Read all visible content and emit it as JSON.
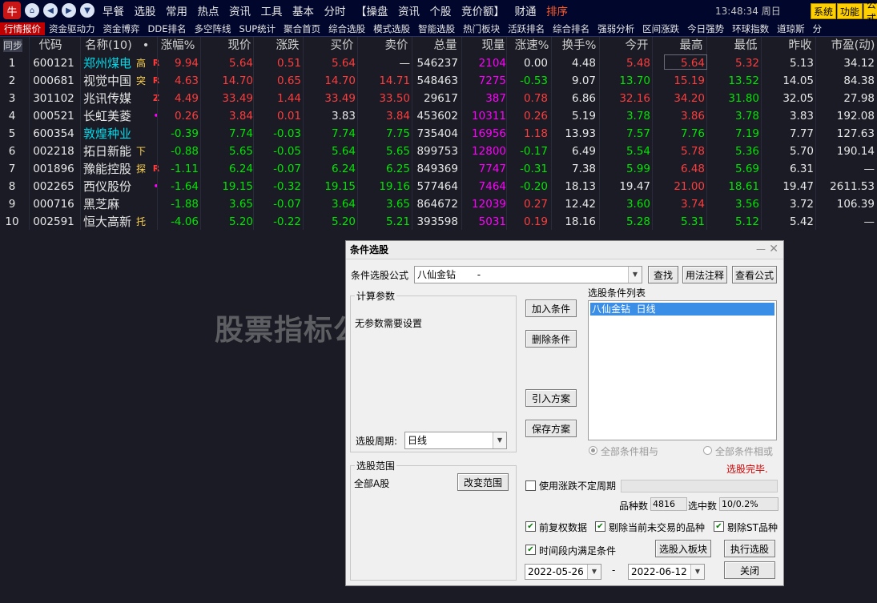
{
  "topbar": {
    "logo": "牛",
    "menu": [
      "早餐",
      "选股",
      "常用",
      "热点",
      "资讯",
      "工具",
      "基本",
      "分时",
      "【操盘",
      "资讯",
      "个股",
      "竞价额】",
      "财通",
      "排序"
    ],
    "clock": "13:48:34 周日",
    "buttons": [
      "系统",
      "功能",
      "公式"
    ]
  },
  "tabs": [
    "行情报价",
    "资金驱动力",
    "资金博弈",
    "DDE排名",
    "多空阵线",
    "SUP统计",
    "聚合首页",
    "综合选股",
    "模式选股",
    "智能选股",
    "热门板块",
    "活跃排名",
    "综合排名",
    "强弱分析",
    "区间涨跌",
    "今日强势",
    "环球指数",
    "道琼斯",
    "分"
  ],
  "table": {
    "headers": [
      "同步",
      "代码",
      "名称(10)",
      "•",
      "涨幅%",
      "现价",
      "涨跌",
      "买价",
      "卖价",
      "总量",
      "现量",
      "涨速%",
      "换手%",
      "今开",
      "最高",
      "最低",
      "昨收",
      "市盈(动)"
    ],
    "rows": [
      {
        "n": "1",
        "code": "600121",
        "name": "郑州煤电",
        "tag": "高",
        "flag": "R",
        "pct": "9.94",
        "price": "5.64",
        "chg": "0.51",
        "bid": "5.64",
        "ask": "—",
        "vol": "546237",
        "cur": "2104",
        "spd": "0.00",
        "turn": "4.48",
        "open": "5.48",
        "high": "5.64",
        "low": "5.32",
        "prev": "5.13",
        "pe": "34.12"
      },
      {
        "n": "2",
        "code": "000681",
        "name": "视觉中国",
        "tag": "突",
        "flag": "R",
        "pct": "4.63",
        "price": "14.70",
        "chg": "0.65",
        "bid": "14.70",
        "ask": "14.71",
        "vol": "548463",
        "cur": "7275",
        "spd": "-0.53",
        "turn": "9.07",
        "open": "13.70",
        "high": "15.19",
        "low": "13.52",
        "prev": "14.05",
        "pe": "84.38"
      },
      {
        "n": "3",
        "code": "301102",
        "name": "兆讯传媒",
        "tag": "",
        "flag": "Z",
        "pct": "4.49",
        "price": "33.49",
        "chg": "1.44",
        "bid": "33.49",
        "ask": "33.50",
        "vol": "29617",
        "cur": "387",
        "spd": "0.78",
        "turn": "6.86",
        "open": "32.16",
        "high": "34.20",
        "low": "31.80",
        "prev": "32.05",
        "pe": "27.98"
      },
      {
        "n": "4",
        "code": "000521",
        "name": "长虹美菱",
        "tag": "",
        "flag": "•",
        "pct": "0.26",
        "price": "3.84",
        "chg": "0.01",
        "bid": "3.83",
        "ask": "3.84",
        "vol": "453602",
        "cur": "10311",
        "spd": "0.26",
        "turn": "5.19",
        "open": "3.78",
        "high": "3.86",
        "low": "3.78",
        "prev": "3.83",
        "pe": "192.08"
      },
      {
        "n": "5",
        "code": "600354",
        "name": "敦煌种业",
        "tag": "",
        "flag": "",
        "pct": "-0.39",
        "price": "7.74",
        "chg": "-0.03",
        "bid": "7.74",
        "ask": "7.75",
        "vol": "735404",
        "cur": "16956",
        "spd": "1.18",
        "turn": "13.93",
        "open": "7.57",
        "high": "7.76",
        "low": "7.19",
        "prev": "7.77",
        "pe": "127.63"
      },
      {
        "n": "6",
        "code": "002218",
        "name": "拓日新能",
        "tag": "下",
        "flag": "",
        "pct": "-0.88",
        "price": "5.65",
        "chg": "-0.05",
        "bid": "5.64",
        "ask": "5.65",
        "vol": "899753",
        "cur": "12800",
        "spd": "-0.17",
        "turn": "6.49",
        "open": "5.54",
        "high": "5.78",
        "low": "5.36",
        "prev": "5.70",
        "pe": "190.14"
      },
      {
        "n": "7",
        "code": "001896",
        "name": "豫能控股",
        "tag": "探",
        "flag": "R",
        "pct": "-1.11",
        "price": "6.24",
        "chg": "-0.07",
        "bid": "6.24",
        "ask": "6.25",
        "vol": "849369",
        "cur": "7747",
        "spd": "-0.31",
        "turn": "7.38",
        "open": "5.99",
        "high": "6.48",
        "low": "5.69",
        "prev": "6.31",
        "pe": "—"
      },
      {
        "n": "8",
        "code": "002265",
        "name": "西仪股份",
        "tag": "",
        "flag": "•",
        "pct": "-1.64",
        "price": "19.15",
        "chg": "-0.32",
        "bid": "19.15",
        "ask": "19.16",
        "vol": "577464",
        "cur": "7464",
        "spd": "-0.20",
        "turn": "18.13",
        "open": "19.47",
        "high": "21.00",
        "low": "18.61",
        "prev": "19.47",
        "pe": "2611.53"
      },
      {
        "n": "9",
        "code": "000716",
        "name": "黑芝麻",
        "tag": "",
        "flag": "",
        "pct": "-1.88",
        "price": "3.65",
        "chg": "-0.07",
        "bid": "3.64",
        "ask": "3.65",
        "vol": "864672",
        "cur": "12039",
        "spd": "0.27",
        "turn": "12.42",
        "open": "3.60",
        "high": "3.74",
        "low": "3.56",
        "prev": "3.72",
        "pe": "106.39"
      },
      {
        "n": "10",
        "code": "002591",
        "name": "恒大高新",
        "tag": "托",
        "flag": "",
        "pct": "-4.06",
        "price": "5.20",
        "chg": "-0.22",
        "bid": "5.20",
        "ask": "5.21",
        "vol": "393598",
        "cur": "5031",
        "spd": "0.19",
        "turn": "18.16",
        "open": "5.28",
        "high": "5.31",
        "low": "5.12",
        "prev": "5.42",
        "pe": "—"
      }
    ]
  },
  "dialog": {
    "title": "条件选股",
    "formula_label": "条件选股公式",
    "formula_value": "八仙金钻       -",
    "btn_find": "查找",
    "btn_usage": "用法注释",
    "btn_view": "查看公式",
    "params_group": "计算参数",
    "params_text": "无参数需要设置",
    "period_label": "选股周期:",
    "period_value": "日线",
    "btn_add": "加入条件",
    "btn_delete": "删除条件",
    "btn_import": "引入方案",
    "btn_save": "保存方案",
    "list_label": "选股条件列表",
    "list_items": [
      "八仙金钻  日线"
    ],
    "radio_and": "全部条件相与",
    "radio_or": "全部条件相或",
    "status": "选股完毕.",
    "range_group": "选股范围",
    "range_value": "全部A股",
    "btn_change_range": "改变范围",
    "chk_period": "使用涨跌不定周期",
    "count_label": "品种数",
    "count_value": "4816",
    "selected_label": "选中数",
    "selected_value": "10/0.2%",
    "chk_fq": "前复权数据",
    "chk_exclude_notrade": "剔除当前未交易的品种",
    "chk_exclude_st": "剔除ST品种",
    "chk_interval": "时间段内满足条件",
    "btn_to_block": "选股入板块",
    "btn_run": "执行选股",
    "date_from": "2022-05-26",
    "date_sep": "-",
    "date_to": "2022-06-12",
    "btn_close": "关闭"
  },
  "watermark": "股票指标公式网www.gpzbgs.com",
  "colors": {
    "up": "#ff3c3c",
    "down": "#00e600",
    "accent_tab": "#c00000",
    "volume": "#ff00ff"
  }
}
